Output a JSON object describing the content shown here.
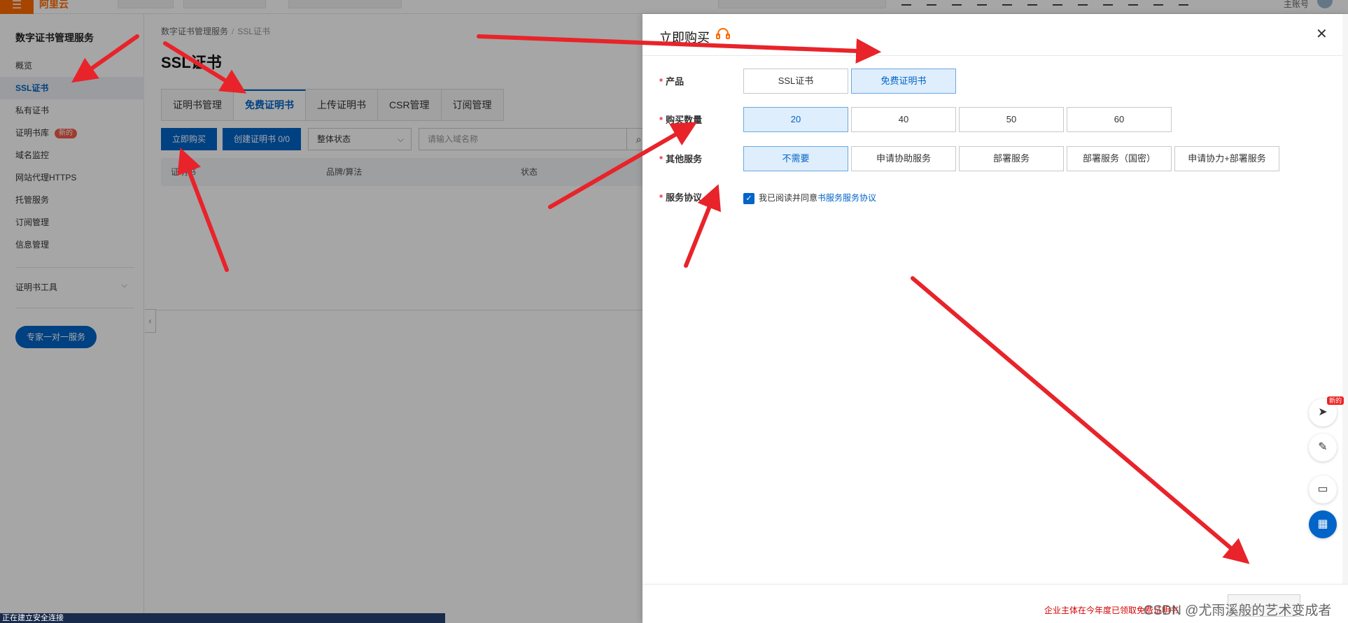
{
  "topbar": {
    "logo_icon": "menu-icon",
    "logo_text": "阿里云",
    "account": "主账号"
  },
  "sidebar": {
    "title": "数字证书管理服务",
    "items": [
      {
        "label": "概览"
      },
      {
        "label": "SSL证书"
      },
      {
        "label": "私有证书"
      },
      {
        "label": "证明书库",
        "badge": "新的"
      },
      {
        "label": "域名监控"
      },
      {
        "label": "网站代理HTTPS"
      },
      {
        "label": "托管服务"
      },
      {
        "label": "订阅管理"
      },
      {
        "label": "信息管理"
      }
    ],
    "tools_label": "证明书工具",
    "expert_button": "专家一对一服务"
  },
  "main": {
    "breadcrumb": [
      "数字证书管理服务",
      "SSL证书"
    ],
    "title": "SSL证书",
    "tabs": [
      "证明书管理",
      "免费证明书",
      "上传证明书",
      "CSR管理",
      "订阅管理"
    ],
    "buy_button": "立即购买",
    "create_button": "创建证明书 0/0",
    "status_select": "整体状态",
    "search_placeholder": "请输入域名称",
    "columns": [
      "证明书",
      "品牌/算法",
      "状态"
    ]
  },
  "drawer": {
    "title": "立即购买",
    "product_label": "产品",
    "products": [
      "SSL证书",
      "免费证明书"
    ],
    "quantity_label": "购买数量",
    "quantities": [
      "20",
      "40",
      "50",
      "60"
    ],
    "service_label": "其他服务",
    "services": [
      "不需要",
      "申请协助服务",
      "部署服务",
      "部署服务（国密）",
      "申请协力+部署服务"
    ],
    "agreement_label": "服务协议",
    "agreement_text": "我已阅读并同意",
    "agreement_link": "书服务服务协议",
    "footer_note": "企业主体在今年度已领取免费证明书",
    "watermark": "CSDN @尤雨溪般的艺术变成者"
  },
  "statusbar": "正在建立安全连接",
  "colors": {
    "brand": "#ff6a00",
    "primary": "#0064c8",
    "arrow": "#e8232a"
  }
}
